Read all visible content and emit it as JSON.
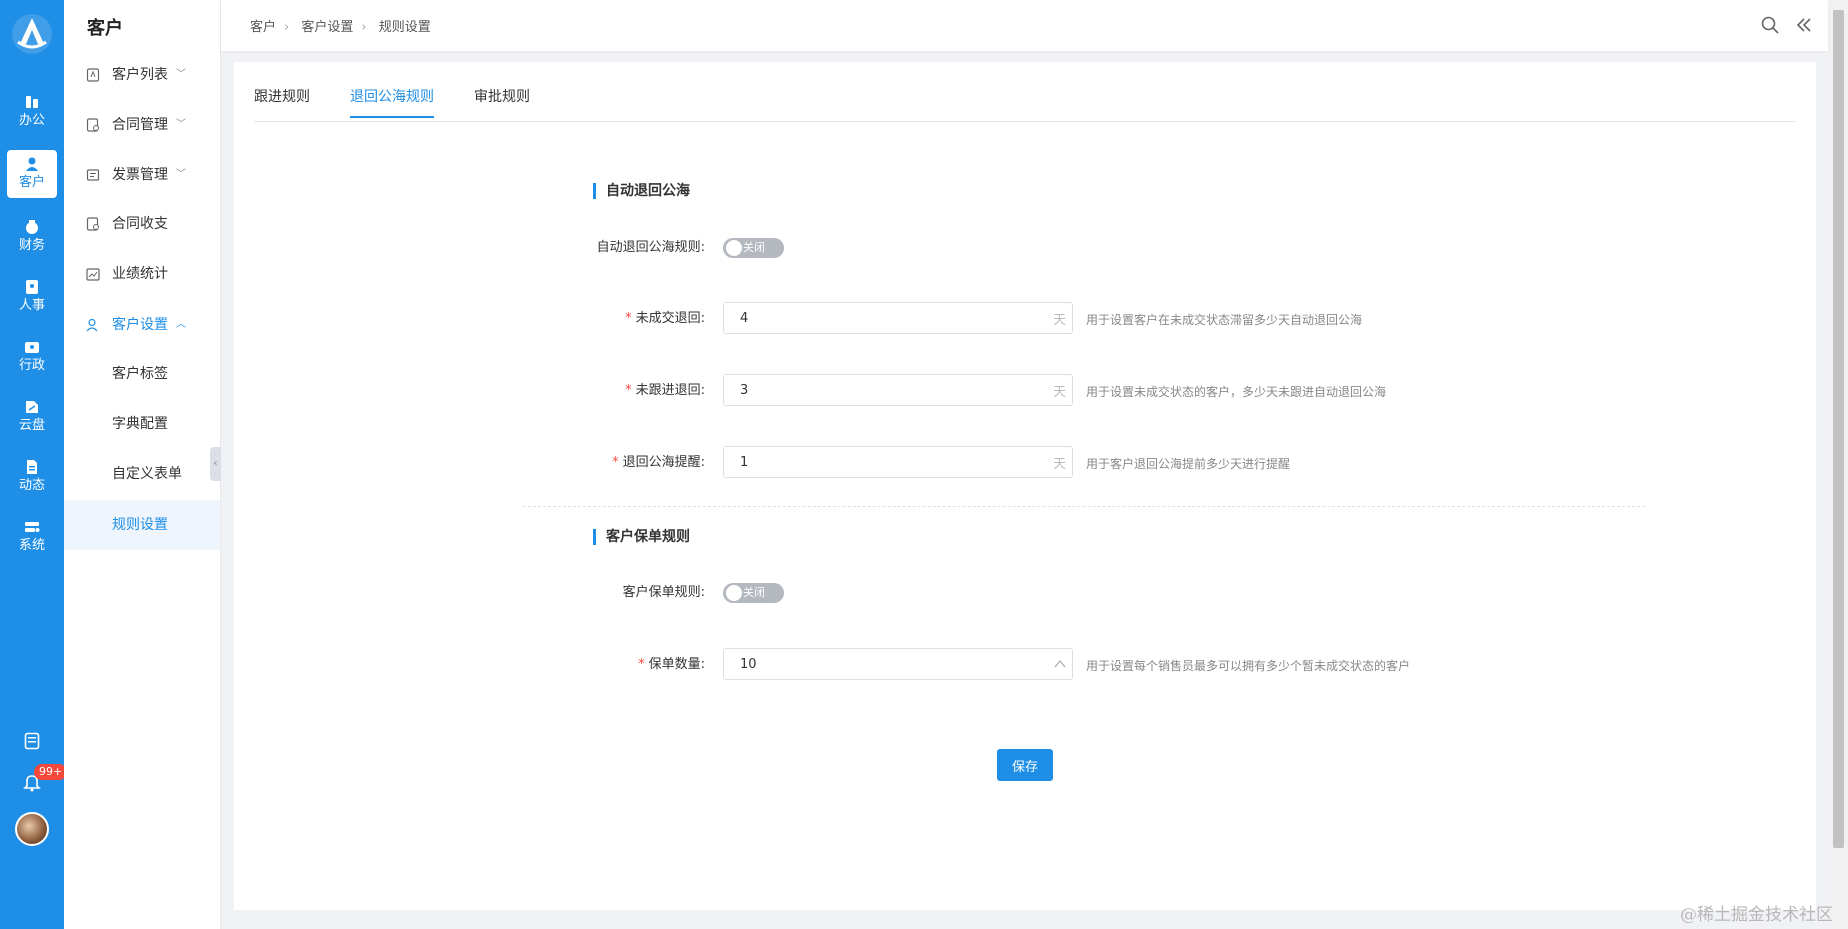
{
  "rail": {
    "items": [
      {
        "label": "办公",
        "icon": "office-icon"
      },
      {
        "label": "客户",
        "icon": "customer-icon"
      },
      {
        "label": "财务",
        "icon": "finance-icon"
      },
      {
        "label": "人事",
        "icon": "hr-icon"
      },
      {
        "label": "行政",
        "icon": "admin-icon"
      },
      {
        "label": "云盘",
        "icon": "cloud-disk-icon"
      },
      {
        "label": "动态",
        "icon": "feed-icon"
      },
      {
        "label": "系统",
        "icon": "system-icon"
      }
    ],
    "active": "客户",
    "notification_badge": "99+"
  },
  "submenu": {
    "title": "客户",
    "items": [
      {
        "label": "客户列表"
      },
      {
        "label": "合同管理"
      },
      {
        "label": "发票管理"
      },
      {
        "label": "合同收支"
      },
      {
        "label": "业绩统计"
      },
      {
        "label": "客户设置"
      },
      {
        "label": "客户标签"
      },
      {
        "label": "字典配置"
      },
      {
        "label": "自定义表单"
      },
      {
        "label": "规则设置"
      }
    ]
  },
  "breadcrumb": [
    "客户",
    "客户设置",
    "规则设置"
  ],
  "tabs": [
    "跟进规则",
    "退回公海规则",
    "审批规则"
  ],
  "active_tab": "退回公海规则",
  "section1": {
    "title": "自动退回公海",
    "switch_label": "自动退回公海规则:",
    "switch_text": "关闭",
    "fields": [
      {
        "label": "未成交退回:",
        "value": "4",
        "suffix": "天",
        "hint": "用于设置客户在未成交状态滞留多少天自动退回公海"
      },
      {
        "label": "未跟进退回:",
        "value": "3",
        "suffix": "天",
        "hint": "用于设置未成交状态的客户，多少天未跟进自动退回公海"
      },
      {
        "label": "退回公海提醒:",
        "value": "1",
        "suffix": "天",
        "hint": "用于客户退回公海提前多少天进行提醒"
      }
    ]
  },
  "section2": {
    "title": "客户保单规则",
    "switch_label": "客户保单规则:",
    "switch_text": "关闭",
    "field": {
      "label": "保单数量:",
      "value": "10",
      "hint": "用于设置每个销售员最多可以拥有多少个暂未成交状态的客户"
    }
  },
  "save_label": "保存",
  "watermark": "@稀土掘金技术社区",
  "colors": {
    "accent": "#1f8ee6",
    "rail_bg": "#1f8ee6",
    "badge": "#f5483b"
  }
}
